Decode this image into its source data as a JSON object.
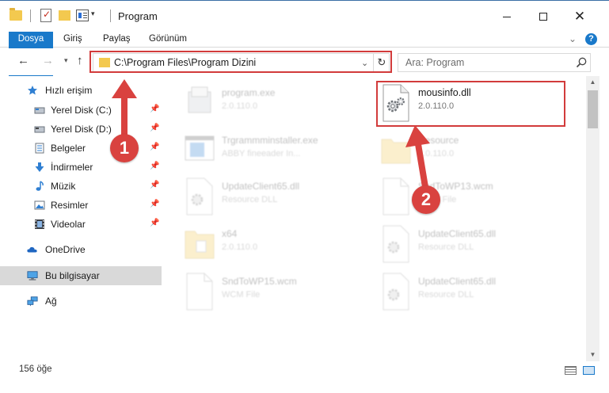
{
  "window": {
    "title": "Program",
    "minimize_label": "",
    "maximize_label": "",
    "close_label": "✕"
  },
  "ribbon": {
    "tabs": [
      "Dosya",
      "Giriş",
      "Paylaş",
      "Görünüm"
    ],
    "help_label": "?"
  },
  "navigation": {
    "address": "C:\\Program Files\\Program Dizini",
    "search_placeholder": "Ara: Program"
  },
  "sidebar": {
    "items": [
      {
        "label": "Hızlı erişim",
        "icon": "star-icon",
        "pinned": false
      },
      {
        "label": "Yerel Disk (C:)",
        "icon": "drive-icon",
        "pinned": true
      },
      {
        "label": "Yerel Disk (D:)",
        "icon": "drive-icon",
        "pinned": true
      },
      {
        "label": "Belgeler",
        "icon": "documents-icon",
        "pinned": true
      },
      {
        "label": "İndirmeler",
        "icon": "download-icon",
        "pinned": true
      },
      {
        "label": "Müzik",
        "icon": "music-icon",
        "pinned": true
      },
      {
        "label": "Resimler",
        "icon": "pictures-icon",
        "pinned": true
      },
      {
        "label": "Videolar",
        "icon": "videos-icon",
        "pinned": true
      },
      {
        "label": "OneDrive",
        "icon": "cloud-icon",
        "pinned": false
      },
      {
        "label": "Bu bilgisayar",
        "icon": "computer-icon",
        "pinned": false,
        "selected": true
      },
      {
        "label": "Ağ",
        "icon": "network-icon",
        "pinned": false
      }
    ]
  },
  "files": [
    {
      "name": "program.exe",
      "sub": "2.0.110.0",
      "icon": "installer-icon"
    },
    {
      "name": "mousinfo.dll",
      "sub": "2.0.110.0",
      "icon": "dll-gear-icon"
    },
    {
      "name": "Trgrammminstaller.exe",
      "sub": "ABBY fineeader In...",
      "icon": "window-icon"
    },
    {
      "name": "Resource",
      "sub": "2.0.110.0",
      "icon": "folder-icon"
    },
    {
      "name": "UpdateClient65.dll",
      "sub": "Resource DLL",
      "icon": "dll-gear-icon"
    },
    {
      "name": "SndToWP13.wcm",
      "sub": "WCM File",
      "icon": "blank-file-icon"
    },
    {
      "name": "x64",
      "sub": "2.0.110.0",
      "icon": "folder-file-icon"
    },
    {
      "name": "UpdateClient65.dll",
      "sub": "Resource DLL",
      "icon": "dll-gear-icon"
    },
    {
      "name": "SndToWP15.wcm",
      "sub": "WCM File",
      "icon": "blank-file-icon"
    },
    {
      "name": "UpdateClient65.dll",
      "sub": "Resource DLL",
      "icon": "dll-gear-icon"
    }
  ],
  "status": {
    "item_count": "156 öğe"
  },
  "annotations": {
    "step1": "1",
    "step2": "2",
    "color": "#d9423f"
  }
}
